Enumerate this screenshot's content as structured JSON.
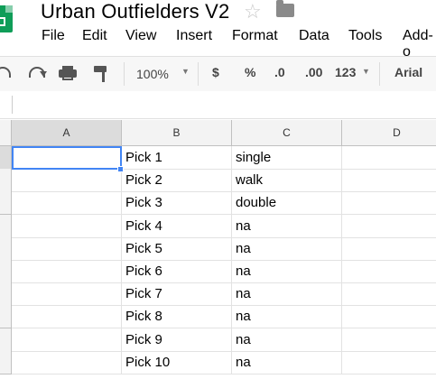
{
  "doc": {
    "title": "Urban Outfielders V2"
  },
  "menu": [
    "File",
    "Edit",
    "View",
    "Insert",
    "Format",
    "Data",
    "Tools",
    "Add-o"
  ],
  "toolbar": {
    "zoom": "100%",
    "currency": "$",
    "percent": "%",
    "dec_less": ".0",
    "dec_more": ".00",
    "number_format": "123",
    "font": "Arial"
  },
  "columns": [
    "A",
    "B",
    "C",
    "D"
  ],
  "rows": [
    {
      "b": "Pick 1",
      "c": "single"
    },
    {
      "b": "Pick 2",
      "c": "walk"
    },
    {
      "b": "Pick 3",
      "c": "double"
    },
    {
      "b": "Pick 4",
      "c": "na"
    },
    {
      "b": "Pick 5",
      "c": "na"
    },
    {
      "b": "Pick 6",
      "c": "na"
    },
    {
      "b": "Pick 7",
      "c": "na"
    },
    {
      "b": "Pick 8",
      "c": "na"
    },
    {
      "b": "Pick 9",
      "c": "na"
    },
    {
      "b": "Pick 10",
      "c": "na"
    }
  ]
}
